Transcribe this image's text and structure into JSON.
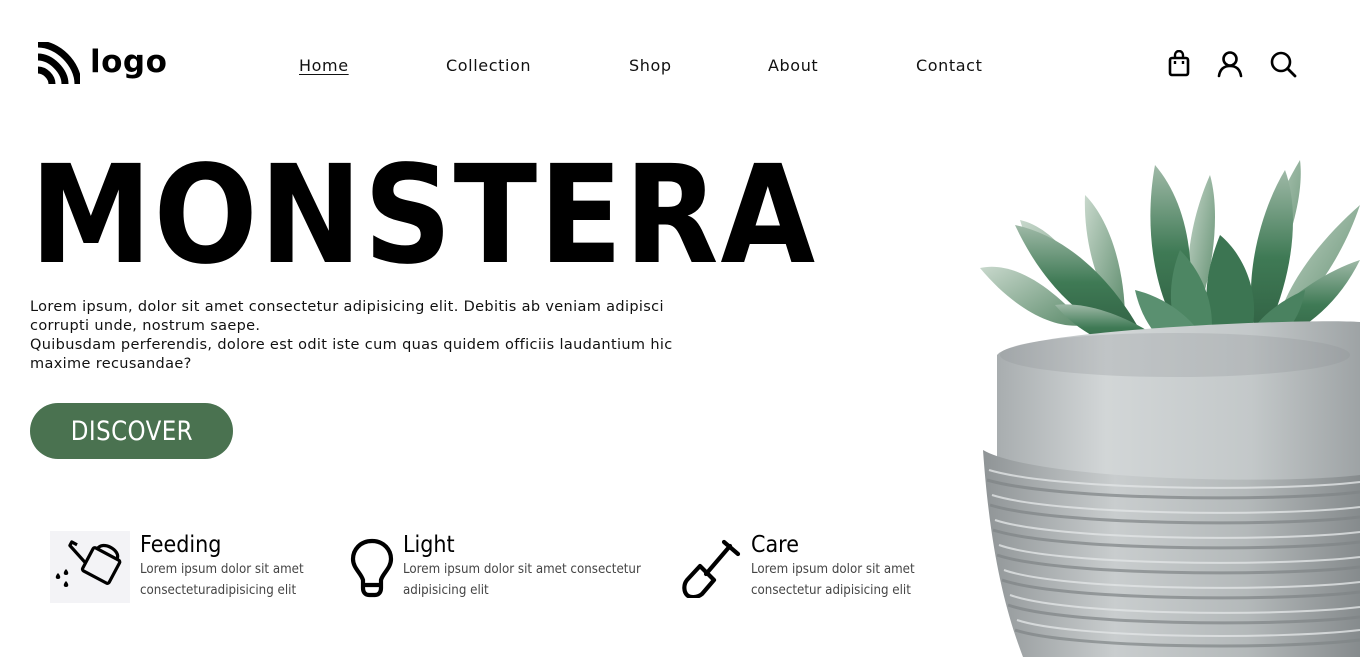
{
  "header": {
    "logo_text": "logo",
    "logo_icon": "wifi-stripes-icon",
    "nav": [
      {
        "label": "Home",
        "active": true
      },
      {
        "label": "Collection",
        "active": false
      },
      {
        "label": "Shop",
        "active": false
      },
      {
        "label": "About",
        "active": false
      },
      {
        "label": "Contact",
        "active": false
      }
    ],
    "icons": [
      "shopping-bag-icon",
      "user-icon",
      "search-icon"
    ]
  },
  "hero": {
    "title": "MONSTERA",
    "description_lines": [
      "Lorem ipsum, dolor sit amet consectetur adipisicing elit. Debitis ab veniam adipisci",
      "corrupti unde, nostrum saepe.",
      "Quibusdam perferendis, dolore est odit iste cum quas quidem officiis laudantium hic",
      "maxime recusandae?"
    ],
    "cta_label": "DISCOVER",
    "cta_color": "#4a7250",
    "image": "potted-succulent-image"
  },
  "features": [
    {
      "icon": "watering-can-icon",
      "title": "Feeding",
      "desc_lines": [
        "Lorem ipsum dolor sit amet",
        "consecteturadipisicing elit"
      ]
    },
    {
      "icon": "light-bulb-icon",
      "title": "Light",
      "desc_lines": [
        "Lorem ipsum dolor sit amet consectetur",
        "adipisicing elit"
      ]
    },
    {
      "icon": "shovel-icon",
      "title": "Care",
      "desc_lines": [
        "Lorem ipsum dolor sit amet",
        "consectetur adipisicing elit"
      ]
    }
  ]
}
